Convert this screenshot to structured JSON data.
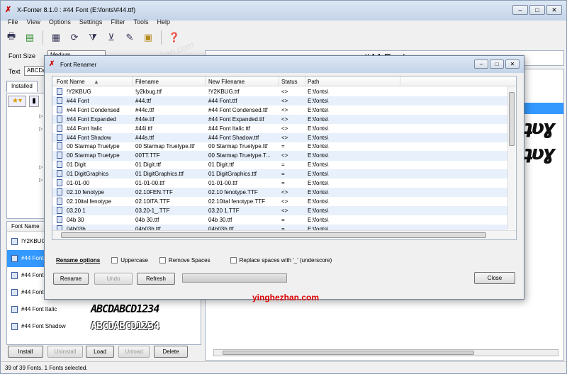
{
  "window": {
    "title": "X-Fonter 8.1.0  :  #44 Font (E:\\fonts\\#44.ttf)",
    "controls": [
      "–",
      "□",
      "✕"
    ]
  },
  "menu": [
    "File",
    "View",
    "Options",
    "Settings",
    "Filter",
    "Tools",
    "Help"
  ],
  "toolbar_icons": [
    "print-icon",
    "print-preview-icon",
    "properties-icon",
    "refresh-icon",
    "filter-icon",
    "clear-filter-icon",
    "font-tools-icon",
    "font-manager-icon",
    "help-icon"
  ],
  "left": {
    "font_size_label": "Font Size",
    "font_size_value": "Medium",
    "text_label": "Text",
    "text_value": "ABCDa",
    "tab_label": "Installed",
    "list_header": "Font Name",
    "fonts": [
      {
        "name": "!Y2KBUG",
        "sample": "",
        "selected": false
      },
      {
        "name": "#44 Font",
        "sample": "",
        "selected": true
      },
      {
        "name": "#44 Font",
        "sample": "",
        "selected": false
      },
      {
        "name": "#44 Font",
        "sample": "",
        "selected": false
      },
      {
        "name": "#44 Font Italic",
        "sample": "ABCDABCD1234",
        "selected": false
      },
      {
        "name": "#44 Font Shadow",
        "sample": "ABCDABCD1234",
        "selected": false
      }
    ],
    "buttons": {
      "install": "Install",
      "uninstall": "Uninstall",
      "load": "Load",
      "unload": "Unload",
      "delete": "Delete"
    }
  },
  "preview_title": "#44 Font",
  "status": "39 of 39 Fonts.   1 Fonts selected.",
  "watermark_text": "yinghezhan.com",
  "dialog": {
    "title": "Font Renamer",
    "columns": [
      "Font Name",
      "Filename",
      "New Filename",
      "Status",
      "Path"
    ],
    "rows": [
      [
        "!Y2KBUG",
        "!y2kbug.ttf",
        "!Y2KBUG.ttf",
        "<>",
        "E:\\fonts\\"
      ],
      [
        "#44 Font",
        "#44.ttf",
        "#44 Font.ttf",
        "<>",
        "E:\\fonts\\"
      ],
      [
        "#44 Font Condensed",
        "#44c.ttf",
        "#44 Font Condensed.ttf",
        "<>",
        "E:\\fonts\\"
      ],
      [
        "#44 Font Expanded",
        "#44e.ttf",
        "#44 Font Expanded.ttf",
        "<>",
        "E:\\fonts\\"
      ],
      [
        "#44 Font Italic",
        "#44i.ttf",
        "#44 Font Italic.ttf",
        "<>",
        "E:\\fonts\\"
      ],
      [
        "#44 Font Shadow",
        "#44s.ttf",
        "#44 Font Shadow.ttf",
        "<>",
        "E:\\fonts\\"
      ],
      [
        "00 Starmap Truetype",
        "00 Starmap Truetype.ttf",
        "00 Starmap Truetype.ttf",
        "=",
        "E:\\fonts\\"
      ],
      [
        "00 Starmap Truetype",
        "00TT.TTF",
        "00 Starmap Truetype.T...",
        "<>",
        "E:\\fonts\\"
      ],
      [
        "01 Digit",
        "01 Digit.ttf",
        "01 Digit.ttf",
        "=",
        "E:\\fonts\\"
      ],
      [
        "01 DigitGraphics",
        "01 DigitGraphics.ttf",
        "01 DigitGraphics.ttf",
        "=",
        "E:\\fonts\\"
      ],
      [
        "01-01-00",
        "01-01-00.ttf",
        "01-01-00.ttf",
        "=",
        "E:\\fonts\\"
      ],
      [
        "02.10 fenotype",
        "02.10FEN.TTF",
        "02.10 fenotype.TTF",
        "<>",
        "E:\\fonts\\"
      ],
      [
        "02.10ital fenotype",
        "02.10ITA.TTF",
        "02.10ital fenotype.TTF",
        "<>",
        "E:\\fonts\\"
      ],
      [
        "03.20 1",
        "03.20-1_.TTF",
        "03.20 1.TTF",
        "<>",
        "E:\\fonts\\"
      ],
      [
        "04b 30",
        "04b 30.ttf",
        "04b 30.ttf",
        "=",
        "E:\\fonts\\"
      ],
      [
        "04b03b",
        "04b03b.ttf",
        "04b03b.ttf",
        "=",
        "E:\\fonts\\"
      ]
    ],
    "options_label": "Rename options",
    "uppercase": "Uppercase",
    "remove_spaces": "Remove Spaces",
    "replace_spaces": "Replace spaces with '_' (underscore)",
    "rename": "Rename",
    "undo": "Undo",
    "refresh": "Refresh",
    "close": "Close"
  }
}
